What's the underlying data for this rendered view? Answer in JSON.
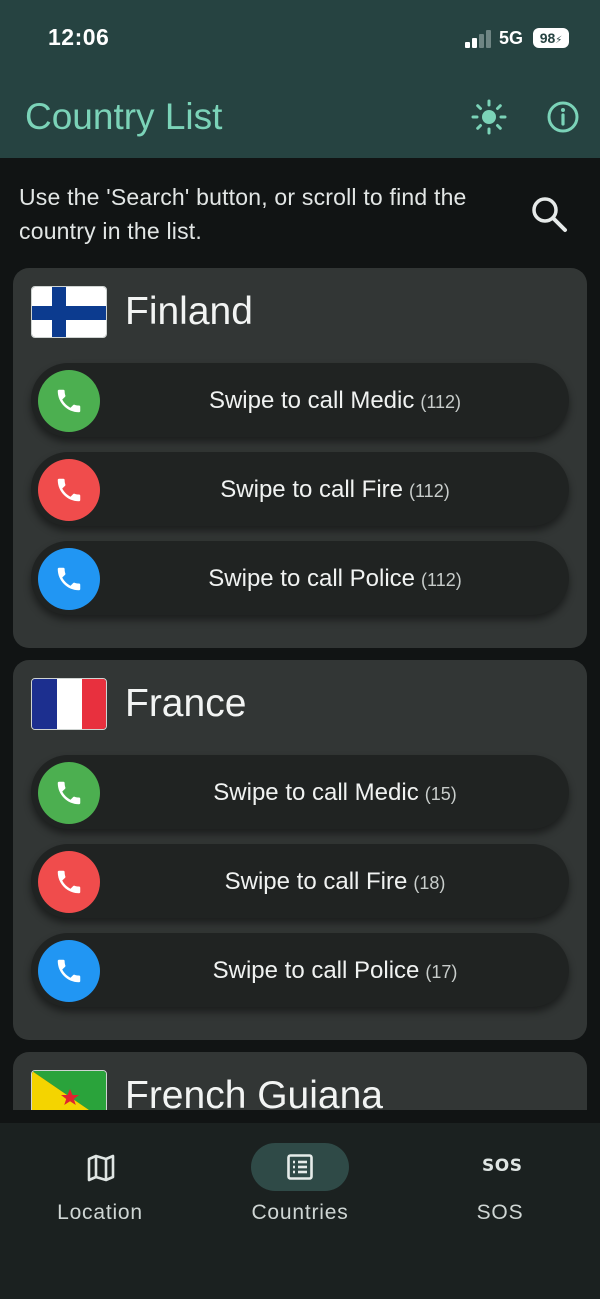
{
  "status_bar": {
    "time": "12:06",
    "network": "5G",
    "battery": "98"
  },
  "header": {
    "title": "Country List",
    "theme_icon": "sun-icon",
    "info_icon": "info-icon"
  },
  "hint": {
    "text": "Use the 'Search' button, or scroll to find the country in the list.",
    "search_icon": "search-icon"
  },
  "colors": {
    "medic": "#4caf50",
    "fire": "#f04c4c",
    "police": "#2196f3",
    "accent": "#7bd3b8"
  },
  "countries": [
    {
      "name": "Finland",
      "services": [
        {
          "label": "Swipe to call Medic",
          "number": "(112)"
        },
        {
          "label": "Swipe to call Fire",
          "number": "(112)"
        },
        {
          "label": "Swipe to call Police",
          "number": "(112)"
        }
      ]
    },
    {
      "name": "France",
      "services": [
        {
          "label": "Swipe to call Medic",
          "number": "(15)"
        },
        {
          "label": "Swipe to call Fire",
          "number": "(18)"
        },
        {
          "label": "Swipe to call Police",
          "number": "(17)"
        }
      ]
    },
    {
      "name": "French Guiana"
    }
  ],
  "nav": {
    "items": [
      {
        "label": "Location",
        "icon": "map-icon"
      },
      {
        "label": "Countries",
        "icon": "list-icon",
        "active": true
      },
      {
        "label": "SOS",
        "icon": "sos-icon",
        "icon_text": "SOS"
      }
    ]
  }
}
